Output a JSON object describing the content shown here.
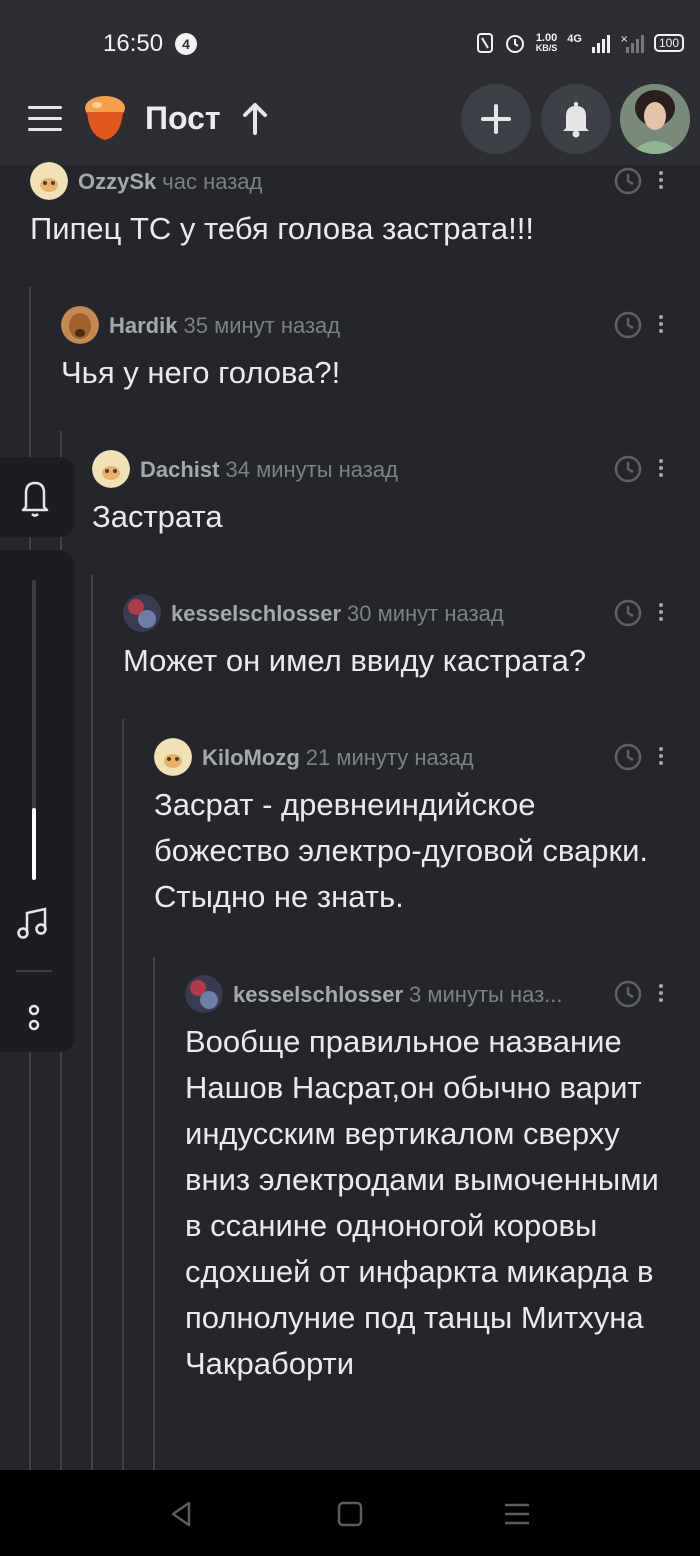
{
  "status_bar": {
    "time": "16:50",
    "notification_count": "4",
    "speed_value": "1.00",
    "speed_unit": "KB/S",
    "network": "4G",
    "battery": "100",
    "icons": [
      "nfc-icon",
      "alarm-icon",
      "signal-icon",
      "signal-off-icon",
      "battery-icon"
    ]
  },
  "header": {
    "title": "Пост",
    "icons": [
      "menu-icon",
      "logo-icon",
      "arrow-up-icon",
      "plus-icon",
      "bell-icon",
      "avatar"
    ]
  },
  "comments": [
    {
      "user": "OzzySk",
      "time": "час назад",
      "text": "Пипец ТС у тебя голова застрата!!!",
      "avatar_color": "#f1e1b5"
    },
    {
      "user": "Hardik",
      "time": "35 минут назад",
      "text": "Чья у него голова?!",
      "avatar_color": "#a0612c"
    },
    {
      "user": "Dachist",
      "time": "34 минуты назад",
      "text": "Застрата",
      "avatar_color": "#f1e1b5"
    },
    {
      "user": "kesselschlosser",
      "time": "30 минут назад",
      "text": "Может он имел ввиду кастрата?",
      "avatar_color": "#3a3a52"
    },
    {
      "user": "KiloMozg",
      "time": "21 минуту назад",
      "text": "Засрат - древнеиндийское божество электро-дуговой сварки. Стыдно не знать.",
      "avatar_color": "#f1e1b5"
    },
    {
      "user": "kesselschlosser",
      "time": "3 минуты наз...",
      "text": "Вообще правильное название Нашов Насрат,он обычно варит индусским вертикалом сверху вниз электродами вымоченными в ссанине одноногой коровы сдохшей от инфаркта микарда в полнолуние под танцы Митхуна Чакраборти",
      "avatar_color": "#3a3a52"
    }
  ],
  "side_panel": {
    "volume_level": 0.24,
    "icons": [
      "bell-outline-icon",
      "music-note-icon",
      "more-dots-icon"
    ]
  },
  "colors": {
    "background": "#24262b",
    "header": "#2c2e33",
    "text": "#e9eaec",
    "meta": "#7c8087",
    "thread_line": "#40434a"
  }
}
